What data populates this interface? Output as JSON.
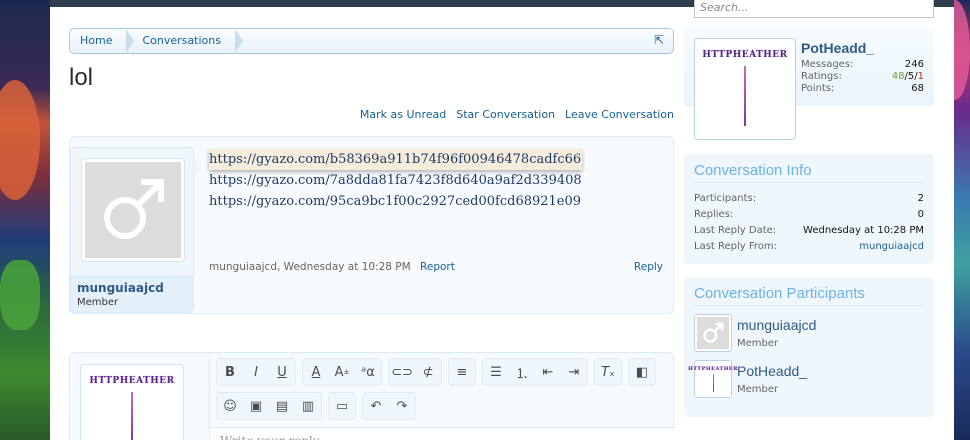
{
  "search": {
    "placeholder": "Search..."
  },
  "breadcrumb": {
    "items": [
      "Home",
      "Conversations"
    ]
  },
  "page_title": "lol",
  "actions": [
    "Mark as Unread",
    "Star Conversation",
    "Leave Conversation"
  ],
  "message": {
    "links": [
      "https://gyazo.com/b58369a911b74f96f00946478cadfc66",
      "https://gyazo.com/7a8dda81fa7423f8d640a9af2d339408",
      "https://gyazo.com/95ca9bc1f00c2927ced00fcd68921e09"
    ],
    "author": "munguiaajcd",
    "author_title": "Member",
    "meta_author": "munguiaajcd",
    "meta_time": ", Wednesday at 10:28 PM",
    "report": "Report",
    "reply": "Reply"
  },
  "quick_reply": {
    "placeholder": "Write your reply...",
    "avatar_logo": "HTTPHEATHER"
  },
  "visitor": {
    "name": "PotHeadd_",
    "logo": "HTTPHEATHER",
    "messages_label": "Messages:",
    "messages": "246",
    "ratings_label": "Ratings:",
    "ratings_pos": "48",
    "ratings_neu": "5",
    "ratings_neg": "1",
    "points_label": "Points:",
    "points": "68"
  },
  "conversation_info": {
    "title": "Conversation Info",
    "participants_label": "Participants:",
    "participants": "2",
    "replies_label": "Replies:",
    "replies": "0",
    "last_reply_date_label": "Last Reply Date:",
    "last_reply_date": "Wednesday at 10:28 PM",
    "last_reply_from_label": "Last Reply From:",
    "last_reply_from": "munguiaajcd"
  },
  "participants": {
    "title": "Conversation Participants",
    "list": [
      {
        "name": "munguiaajcd",
        "title": "Member"
      },
      {
        "name": "PotHeadd_",
        "title": "Member"
      }
    ]
  },
  "colors": {
    "link": "#176093",
    "accent": "#6cb2e4",
    "username": "#2f5a86"
  }
}
